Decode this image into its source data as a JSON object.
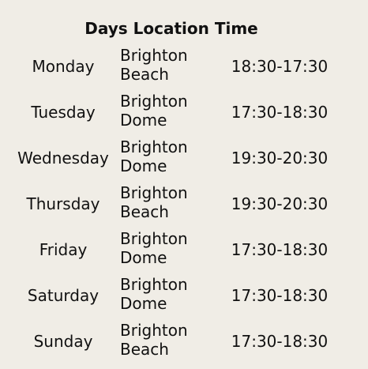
{
  "header": {
    "title": "Days Location Time"
  },
  "rows": [
    {
      "day": "Monday",
      "location_line1": "Brighton",
      "location_line2": "Beach",
      "time": "18:30-17:30"
    },
    {
      "day": "Tuesday",
      "location_line1": "Brighton",
      "location_line2": "Dome",
      "time": "17:30-18:30"
    },
    {
      "day": "Wednesday",
      "location_line1": "Brighton",
      "location_line2": "Dome",
      "time": "19:30-20:30"
    },
    {
      "day": "Thursday",
      "location_line1": "Brighton",
      "location_line2": "Beach",
      "time": "19:30-20:30"
    },
    {
      "day": "Friday",
      "location_line1": "Brighton",
      "location_line2": "Dome",
      "time": "17:30-18:30"
    },
    {
      "day": "Saturday",
      "location_line1": "Brighton",
      "location_line2": "Dome",
      "time": "17:30-18:30"
    },
    {
      "day": "Sunday",
      "location_line1": "Brighton",
      "location_line2": "Beach",
      "time": "17:30-18:30"
    }
  ]
}
